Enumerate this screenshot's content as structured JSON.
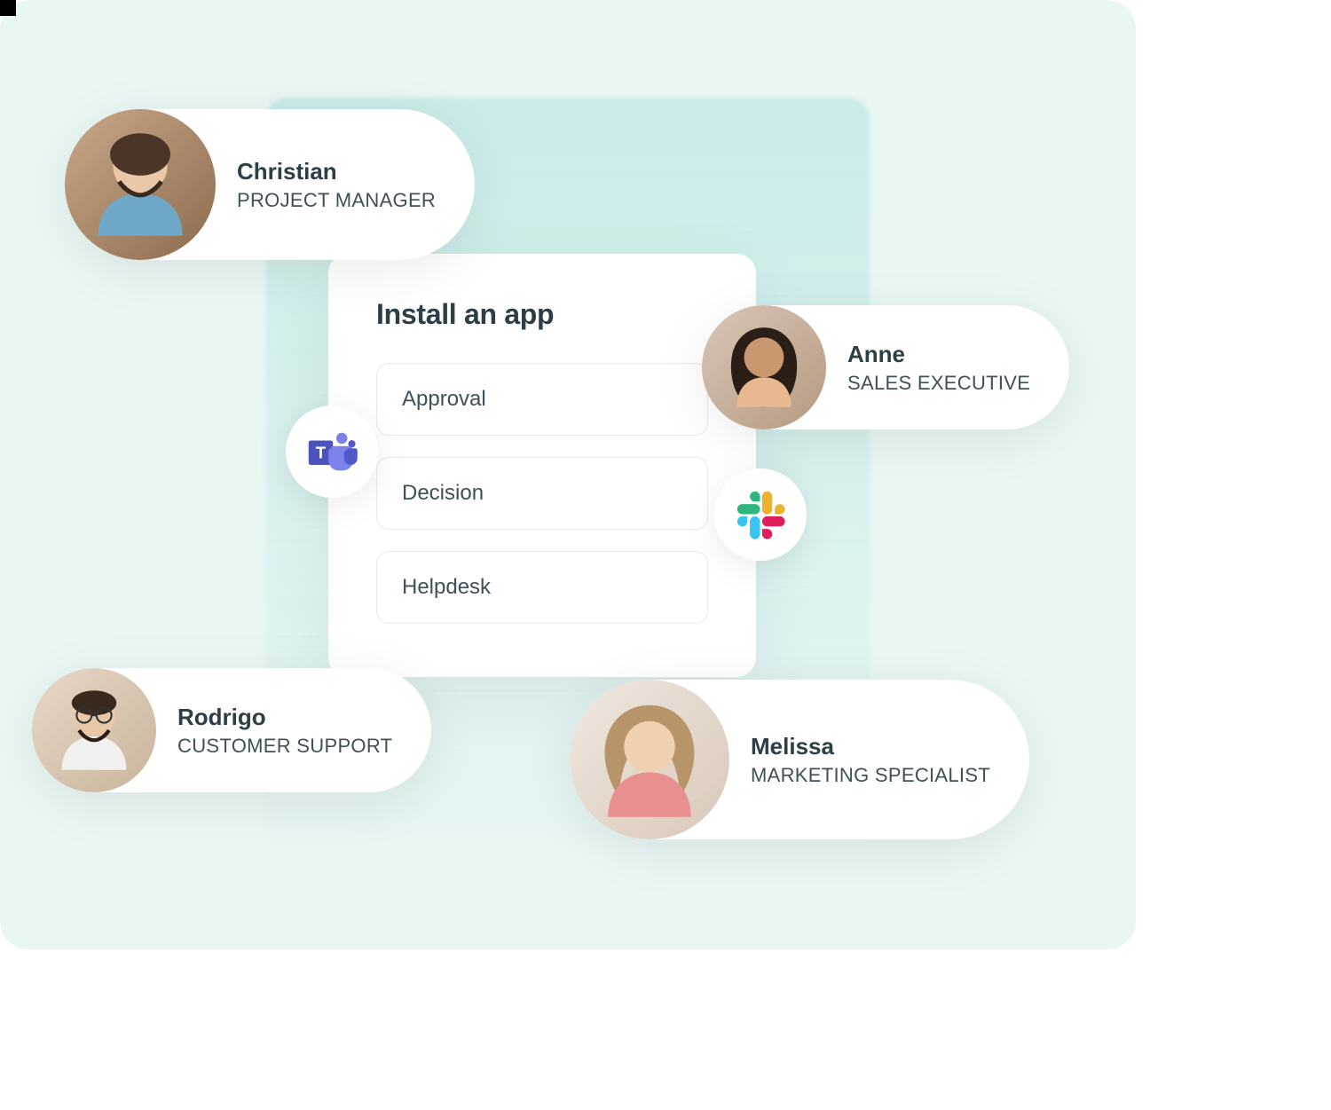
{
  "card": {
    "title": "Install an app",
    "options": [
      {
        "label": "Approval"
      },
      {
        "label": "Decision"
      },
      {
        "label": "Helpdesk"
      }
    ]
  },
  "people": {
    "christian": {
      "name": "Christian",
      "role": "PROJECT MANAGER"
    },
    "anne": {
      "name": "Anne",
      "role": "SALES EXECUTIVE"
    },
    "rodrigo": {
      "name": "Rodrigo",
      "role": "CUSTOMER SUPPORT"
    },
    "melissa": {
      "name": "Melissa",
      "role": "MARKETING SPECIALIST"
    }
  },
  "icons": {
    "teams": "microsoft-teams-icon",
    "slack": "slack-icon"
  }
}
